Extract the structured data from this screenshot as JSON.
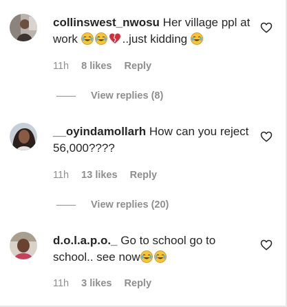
{
  "comments": [
    {
      "username": "collinswest_nwosu",
      "text_parts": [
        "Her village ppl at work ",
        "..just kidding "
      ],
      "time": "11h",
      "likes": "8 likes",
      "reply": "Reply",
      "view_replies": "View replies (8)"
    },
    {
      "username": "__oyindamollarh",
      "text": "How can you reject 56,000????",
      "time": "11h",
      "likes": "13 likes",
      "reply": "Reply",
      "view_replies": "View replies (20)"
    },
    {
      "username": "d.o.l.a.p.o._",
      "text": "Go to school go to school.. see now",
      "time": "11h",
      "likes": "3 likes",
      "reply": "Reply"
    }
  ],
  "icons": {
    "like": "heart-outline-icon",
    "laugh": "face-with-tears-of-joy-emoji",
    "heart": "red-heart-emoji",
    "broken": "broken-heart-emoji"
  },
  "colors": {
    "text": "#262626",
    "secondary": "#8e8e8e",
    "heart_red": "#d62d3b"
  }
}
